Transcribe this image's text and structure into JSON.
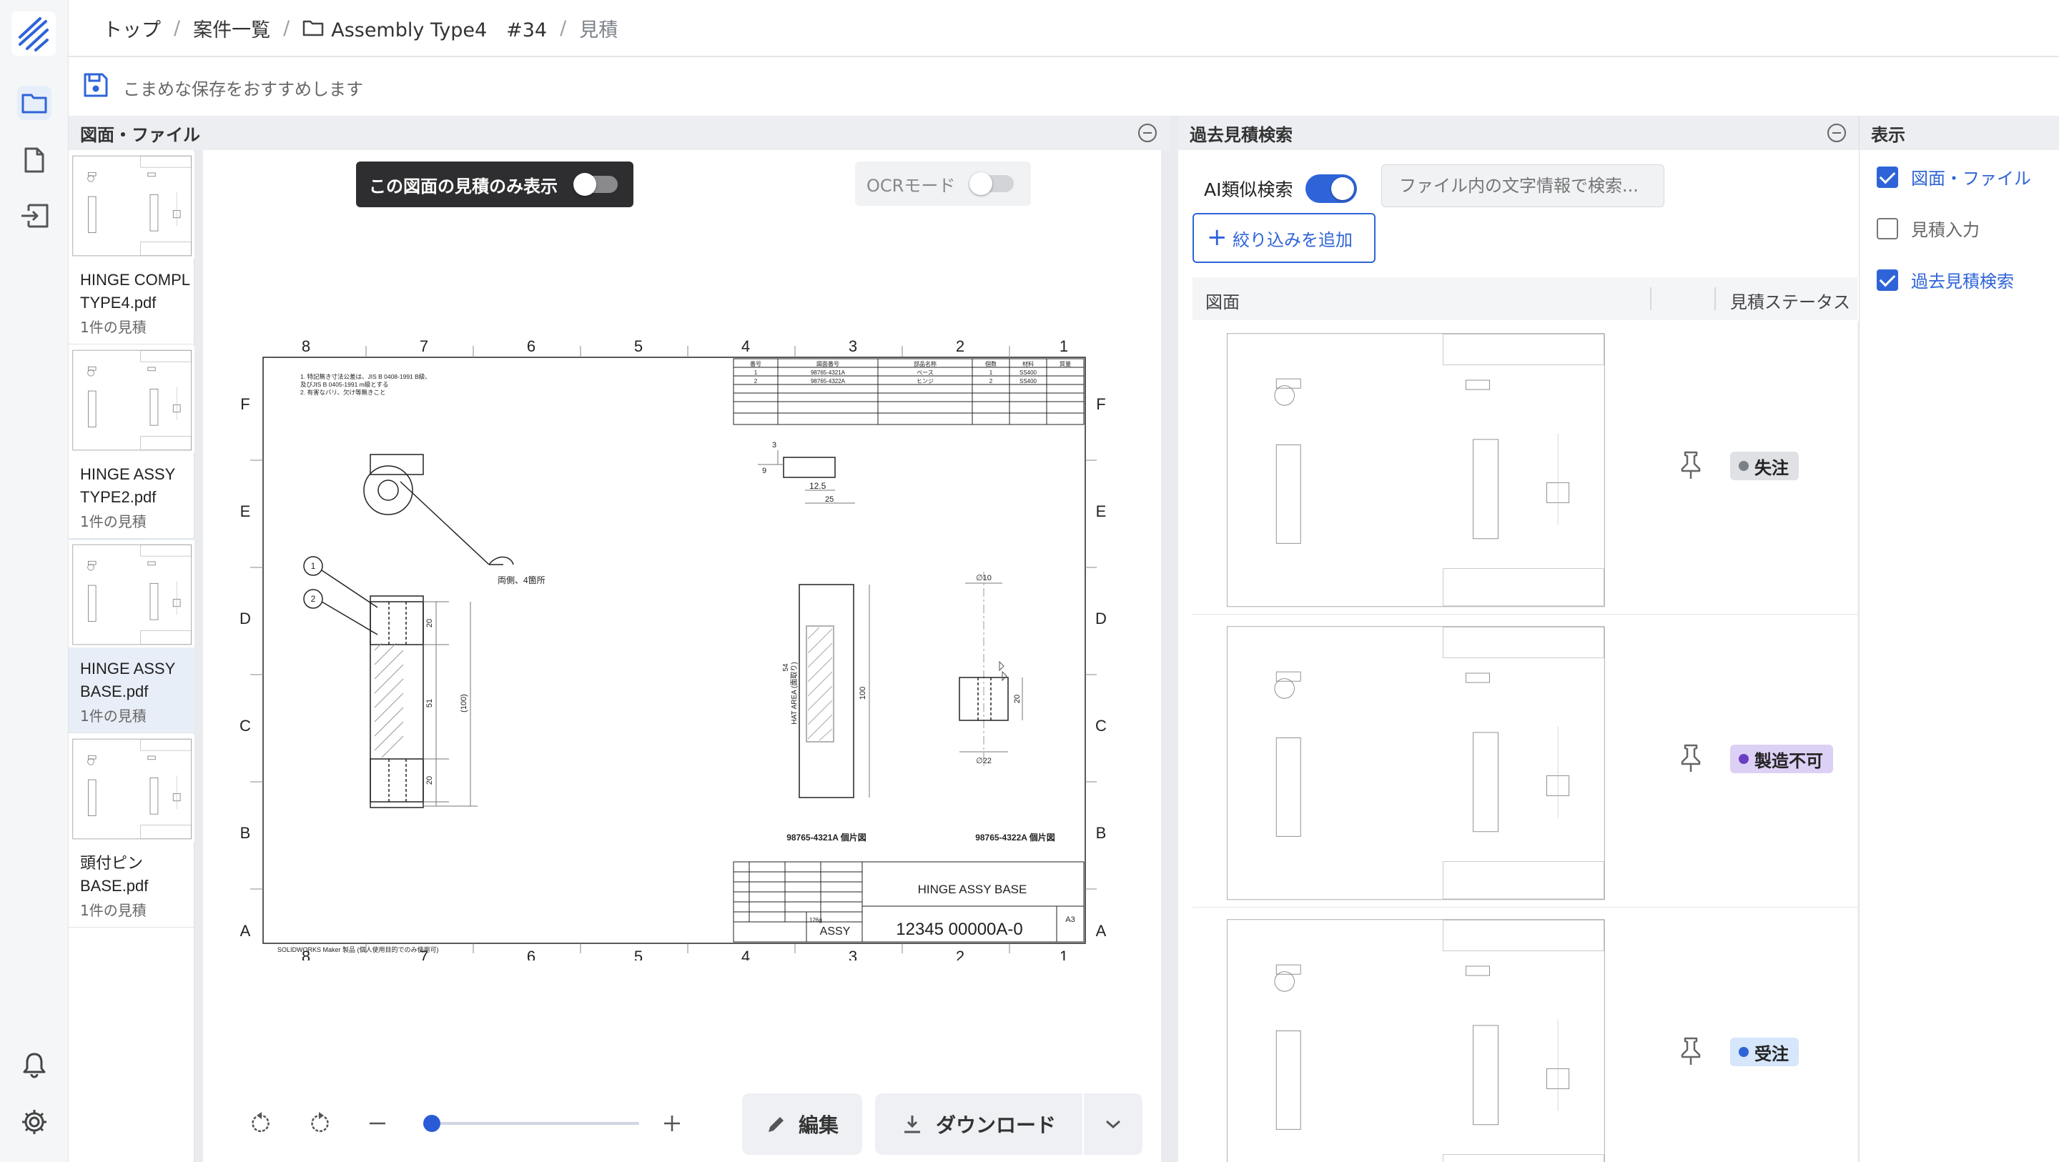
{
  "breadcrumb": {
    "top": "トップ",
    "cases": "案件一覧",
    "project": "Assembly Type4　#34",
    "current": "見積",
    "sep": "/"
  },
  "notice": {
    "text": "こまめな保存をおすすめします"
  },
  "panels": {
    "files_title": "図面・ファイル",
    "search_title": "過去見積検索",
    "display_title": "表示"
  },
  "files": [
    {
      "name": "HINGE COMPL TYPE4.pdf",
      "count": "1件の見積"
    },
    {
      "name": "HINGE ASSY TYPE2.pdf",
      "count": "1件の見積"
    },
    {
      "name": "HINGE ASSY BASE.pdf",
      "count": "1件の見積",
      "selected": true
    },
    {
      "name": "頭付ピン BASE.pdf",
      "count": "1件の見積"
    }
  ],
  "viewer": {
    "only_toggle_label": "この図面の見積のみ表示",
    "only_toggle_on": false,
    "ocr_label": "OCRモード",
    "ocr_on": false,
    "zoom_level": 0,
    "edit_label": "編集",
    "download_label": "ダウンロード"
  },
  "drawing": {
    "col_labels": [
      "8",
      "7",
      "6",
      "5",
      "4",
      "3",
      "2",
      "1"
    ],
    "row_labels": [
      "F",
      "E",
      "D",
      "C",
      "B",
      "A"
    ],
    "notes": [
      "1. 特記無き寸法公差は、JIS B 0408-1991 B級、",
      "   及びJIS B 0405-1991 m級とする",
      "2. 有害なバリ、欠け等無きこと"
    ],
    "bom_head": [
      "番号",
      "図面番号",
      "部品名称",
      "個数",
      "材料",
      "質量"
    ],
    "bom_rows": [
      [
        "1",
        "98765-4321A",
        "ベース",
        "1",
        "SS400",
        ""
      ],
      [
        "2",
        "98765-4322A",
        "ヒンジ",
        "2",
        "SS400",
        ""
      ]
    ],
    "note_both_sides": "両側、4箇所",
    "dims": {
      "d20a": "20",
      "d51": "51",
      "d100": "(100)",
      "d20b": "20",
      "d54": "54",
      "hat_area": "HAT AREA (面取り)",
      "d100b": "100",
      "d3": "3",
      "d9": "9",
      "d12_5": "12.5",
      "d25": "25",
      "phi10": "∅10",
      "phi22": "∅22",
      "d20c": "20"
    },
    "view_label_1": "98765-4321A 個片図",
    "view_label_2": "98765-4322A 個片図",
    "balloons": [
      "1",
      "2"
    ],
    "title": "HINGE ASSY BASE",
    "assy": "ASSY",
    "drawing_no": "12345 00000A-0",
    "sheet_size": "A3",
    "weight": "126g",
    "footer": "SOLIDWORKS Maker 製品 (個人使用目的でのみ使用可)"
  },
  "search": {
    "ai_label": "AI類似検索",
    "ai_on": true,
    "placeholder": "ファイル内の文字情報で検索...",
    "filter_label": "絞り込みを追加",
    "col_drawing": "図面",
    "col_status": "見積ステータス",
    "results": [
      {
        "status": "失注",
        "dot": "#7b8086",
        "bg": "#dfe1e4"
      },
      {
        "status": "製造不可",
        "dot": "#6a3fc4",
        "bg": "#ddd0f5"
      },
      {
        "status": "受注",
        "dot": "#2f64d8",
        "bg": "#d6e6fb"
      }
    ]
  },
  "display_options": [
    {
      "label": "図面・ファイル",
      "checked": true
    },
    {
      "label": "見積入力",
      "checked": false
    },
    {
      "label": "過去見積検索",
      "checked": true
    }
  ],
  "colors": {
    "accent": "#2f64d8",
    "rail_bg": "#f5f6f8",
    "toggle_dark": "#2e2e30"
  }
}
